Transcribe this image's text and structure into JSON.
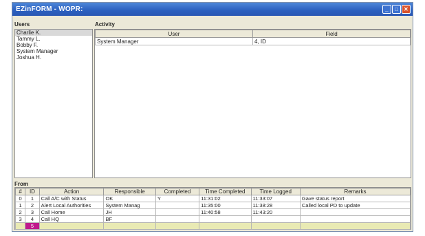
{
  "window": {
    "title": "EZinFORM - WOPR:"
  },
  "users": {
    "label": "Users",
    "items": [
      "Charlie K.",
      "Tammy L.",
      "Bobby F.",
      "System Manager",
      "Joshua H."
    ]
  },
  "activity": {
    "label": "Activity",
    "columns": [
      "User",
      "Field"
    ],
    "rows": [
      [
        "System Manager",
        "4, ID"
      ]
    ]
  },
  "from": {
    "label": "From",
    "columns": [
      "#",
      "ID",
      "Action",
      "Responsible",
      "Completed",
      "Time Completed",
      "Time Logged",
      "Remarks"
    ],
    "rows": [
      [
        "0",
        "1",
        "Call A/C with Status",
        "OK",
        "Y",
        "11:31:02",
        "11:33:07",
        "Gave status report"
      ],
      [
        "1",
        "2",
        "Alert Local Authorities",
        "System Manag",
        "",
        "11:35:00",
        "11:38:28",
        "Called local PD to update"
      ],
      [
        "2",
        "3",
        "Call Home",
        "JH",
        "",
        "11:40:58",
        "11:43:20",
        ""
      ],
      [
        "3",
        "4",
        "Call HQ",
        "BF",
        "",
        "",
        "",
        ""
      ]
    ],
    "new_row": [
      "",
      "5",
      "",
      "",
      "",
      "",
      "",
      ""
    ]
  }
}
